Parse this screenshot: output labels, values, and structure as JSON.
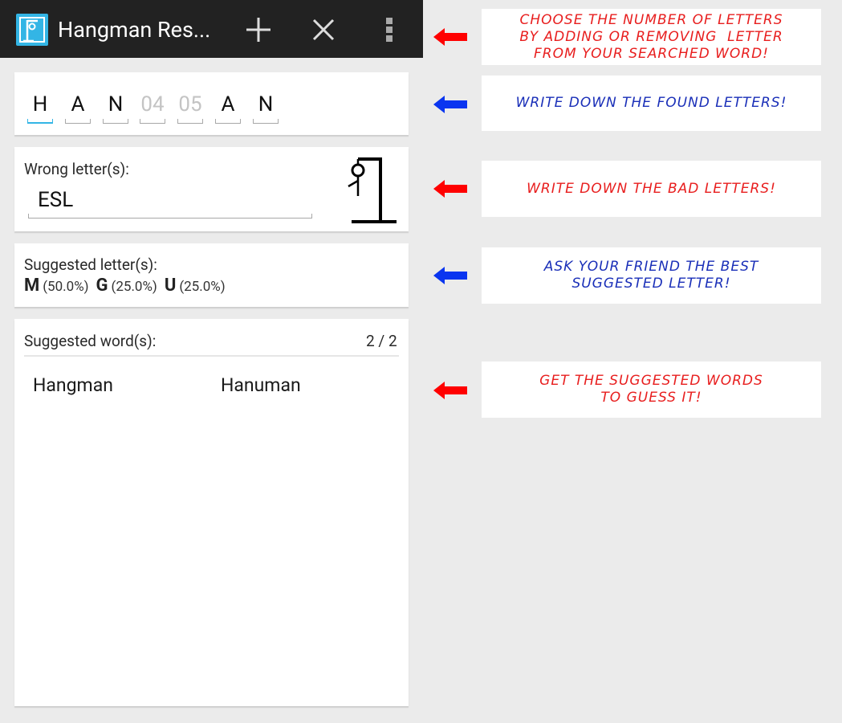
{
  "actionbar": {
    "app_icon": "gallows-app-icon",
    "title": "Hangman Res...",
    "add_icon": "plus-icon",
    "close_icon": "close-icon",
    "overflow_icon": "overflow-menu-icon"
  },
  "word_slots": [
    {
      "value": "H",
      "hint": false,
      "active": true
    },
    {
      "value": "A",
      "hint": false,
      "active": false
    },
    {
      "value": "N",
      "hint": false,
      "active": false
    },
    {
      "value": "04",
      "hint": true,
      "active": false
    },
    {
      "value": "05",
      "hint": true,
      "active": false
    },
    {
      "value": "A",
      "hint": false,
      "active": false
    },
    {
      "value": "N",
      "hint": false,
      "active": false
    }
  ],
  "wrong": {
    "label": "Wrong letter(s):",
    "value": "ESL",
    "image": "hangman-gallows-icon"
  },
  "suggested_letters": {
    "label": "Suggested letter(s):",
    "items": [
      {
        "letter": "M",
        "percent": "(50.0%)"
      },
      {
        "letter": "G",
        "percent": "(25.0%)"
      },
      {
        "letter": "U",
        "percent": "(25.0%)"
      }
    ]
  },
  "suggested_words": {
    "label": "Suggested word(s):",
    "count": "2 / 2",
    "words": [
      "Hangman",
      "Hanuman"
    ]
  },
  "annotations": [
    {
      "text": "CHOOSE THE NUMBER OF LETTERS\nBY ADDING OR REMOVING  LETTER\nFROM YOUR SEARCHED WORD!",
      "color": "#e81e1e",
      "arrow_color": "#ff0000"
    },
    {
      "text": "WRITE DOWN THE FOUND LETTERS!",
      "color": "#1a2fb8",
      "arrow_color": "#0a35f0"
    },
    {
      "text": "WRITE DOWN THE BAD LETTERS!",
      "color": "#e81e1e",
      "arrow_color": "#ff0000"
    },
    {
      "text": "ASK YOUR FRIEND THE BEST\nSUGGESTED LETTER!",
      "color": "#1a2fb8",
      "arrow_color": "#0a35f0"
    },
    {
      "text": "GET THE SUGGESTED WORDS\nTO GUESS IT!",
      "color": "#e81e1e",
      "arrow_color": "#ff0000"
    }
  ],
  "colors": {
    "actionbar": "#222222",
    "accent": "#33b5e5",
    "background": "#ebebeb"
  }
}
